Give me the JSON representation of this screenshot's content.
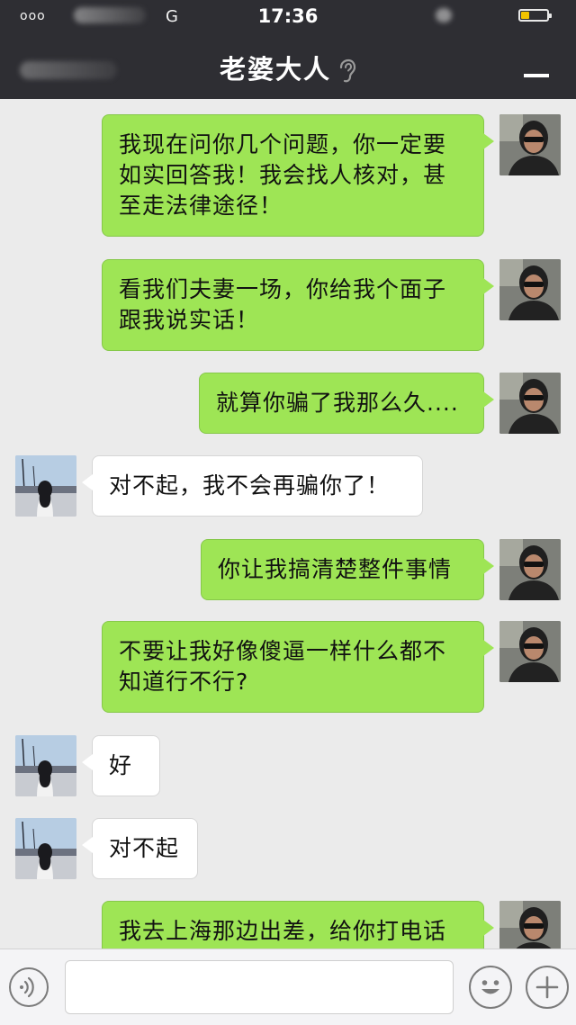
{
  "status_bar": {
    "signal": "ooo",
    "network": "G",
    "time": "17:36"
  },
  "header": {
    "title": "老婆大人",
    "title_icon": "ear-icon",
    "menu_icon": "menu-icon"
  },
  "messages": [
    {
      "from": "me",
      "text": "我现在问你几个问题，你一定要如实回答我！我会找人核对，甚至走法律途径！"
    },
    {
      "from": "me",
      "text": "看我们夫妻一场，你给我个面子跟我说实话！"
    },
    {
      "from": "me",
      "text": "就算你骗了我那么久...."
    },
    {
      "from": "her",
      "text": "对不起，我不会再骗你了！"
    },
    {
      "from": "me",
      "text": "你让我搞清楚整件事情"
    },
    {
      "from": "me",
      "text": "不要让我好像傻逼一样什么都不知道行不行?"
    },
    {
      "from": "her",
      "text": "好"
    },
    {
      "from": "her",
      "text": "对不起"
    },
    {
      "from": "me",
      "text": "我去上海那边出差，给你打电话"
    }
  ],
  "input_bar": {
    "voice_icon": "voice-icon",
    "emoji_icon": "emoji-icon",
    "plus_icon": "plus-icon",
    "value": "",
    "placeholder": ""
  },
  "colors": {
    "header_bg": "#2e2e33",
    "chat_bg": "#ebebeb",
    "my_bubble": "#9ee555",
    "her_bubble": "#ffffff",
    "battery": "#f3c300"
  }
}
